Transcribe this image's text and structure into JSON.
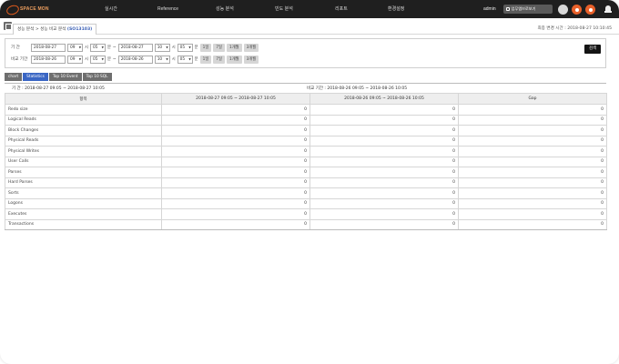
{
  "app": {
    "logo_text": "SPACE MON"
  },
  "nav": {
    "items": [
      "실시간",
      "Reference",
      "성능 분석",
      "빈도 분석",
      "리포트",
      "환경설정"
    ]
  },
  "user": {
    "name": "admin",
    "tip_button": "업무엠브로보기"
  },
  "breadcrumb": {
    "path": "성능 분석 > 성능 비교 분석",
    "code": "(SO13103)"
  },
  "last_updated": "최종 변경 시간 : 2018-08-27 10:10:45",
  "search": {
    "period_label": "기    간",
    "compare_label": "비교 기간",
    "row1": {
      "start_date": "2018-08-27",
      "start_hour": "09",
      "start_min": "05",
      "end_date": "2018-08-27",
      "end_hour": "10",
      "end_min": "05"
    },
    "row2": {
      "start_date": "2018-08-26",
      "start_hour": "09",
      "start_min": "05",
      "end_date": "2018-08-26",
      "end_hour": "10",
      "end_min": "05"
    },
    "hour_unit": "시",
    "min_unit": "분",
    "tilde": "~",
    "quick_buttons": [
      "1일",
      "7일",
      "1개월",
      "3개월"
    ],
    "search_button": "검색"
  },
  "tabs": [
    "chart",
    "Statistics",
    "Top 10 Event",
    "Top 10 SQL"
  ],
  "active_tab": "Statistics",
  "period_strip": {
    "period": "기    간 : 2018-08-27 09:05 ~ 2018-08-27 10:05",
    "compare": "비교 기간 : 2018-08-26 09:05 ~ 2018-08-26 10:05"
  },
  "table": {
    "headers": [
      "항목",
      "2018-08-27 09:05 ~ 2018-08-27 10:05",
      "2018-08-26 09:05 ~ 2018-08-26 10:05",
      "Gap"
    ],
    "rows": [
      [
        "Redo size",
        "0",
        "0",
        "0"
      ],
      [
        "Logical Reads",
        "0",
        "0",
        "0"
      ],
      [
        "Block Changes",
        "0",
        "0",
        "0"
      ],
      [
        "Physical Reads",
        "0",
        "0",
        "0"
      ],
      [
        "Physical Writes",
        "0",
        "0",
        "0"
      ],
      [
        "User Calls",
        "0",
        "0",
        "0"
      ],
      [
        "Parses",
        "0",
        "0",
        "0"
      ],
      [
        "Hard Parses",
        "0",
        "0",
        "0"
      ],
      [
        "Sorts",
        "0",
        "0",
        "0"
      ],
      [
        "Logons",
        "0",
        "0",
        "0"
      ],
      [
        "Executes",
        "0",
        "0",
        "0"
      ],
      [
        "Transactions",
        "0",
        "0",
        "0"
      ]
    ]
  },
  "colors": {
    "topbar": "#1f1f1f",
    "accent": "#e8602a",
    "active_tab": "#3a66c4",
    "code_text": "#3a5fb5"
  }
}
